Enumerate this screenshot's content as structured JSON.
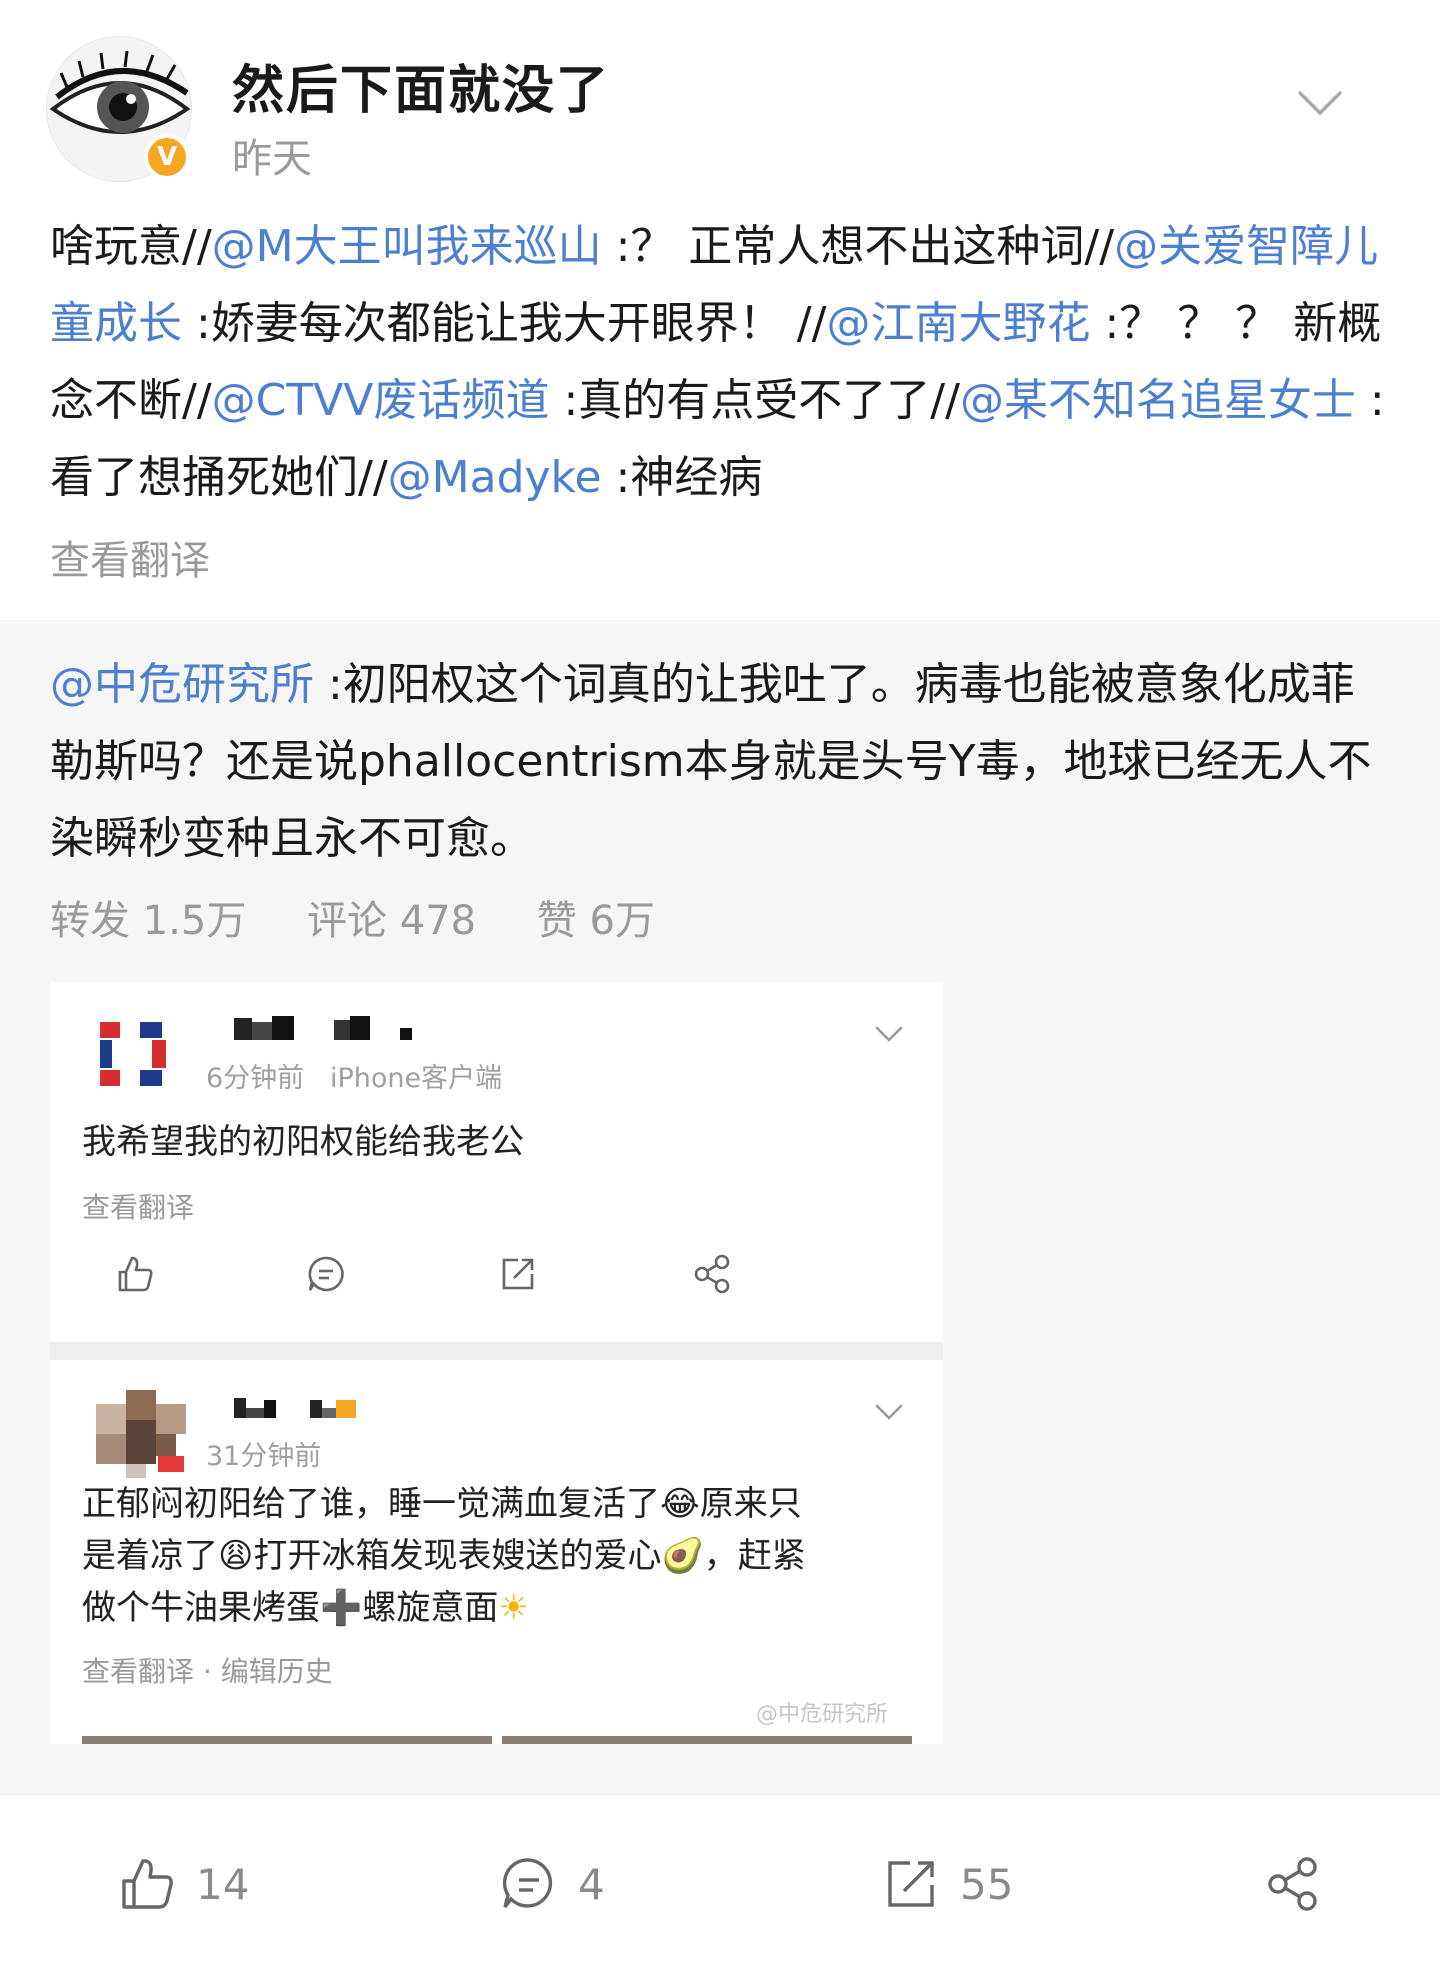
{
  "post": {
    "author": "然后下面就没了",
    "time": "昨天",
    "verified_badge": "V",
    "segments": [
      {
        "t": "啥玩意//",
        "m": false
      },
      {
        "t": "@M大王叫我来巡山",
        "m": true
      },
      {
        "t": " :？ 正常人想不出这种词//",
        "m": false
      },
      {
        "t": "@关爱智障儿童成长",
        "m": true
      },
      {
        "t": " :娇妻每次都能让我大开眼界！ //",
        "m": false
      },
      {
        "t": "@江南大野花",
        "m": true
      },
      {
        "t": " :？ ？ ？ 新概念不断//",
        "m": false
      },
      {
        "t": "@CTVV废话频道",
        "m": true
      },
      {
        "t": " :真的有点受不了了//",
        "m": false
      },
      {
        "t": "@某不知名追星女士",
        "m": true
      },
      {
        "t": " :看了想捅死她们//",
        "m": false
      },
      {
        "t": "@Madyke",
        "m": true
      },
      {
        "t": " :神经病",
        "m": false
      }
    ],
    "translate_label": "查看翻译"
  },
  "repost": {
    "mention": "@中危研究所",
    "text": " :初阳权这个词真的让我吐了。病毒也能被意象化成菲勒斯吗？还是说phallocentrism本身就是头号Y毒，地球已经无人不染瞬秒变种且永不可愈。",
    "stats": {
      "forward_label": "转发 1.5万",
      "comment_label": "评论 478",
      "like_label": "赞 6万"
    }
  },
  "card1": {
    "time": "6分钟前",
    "client": "iPhone客户端",
    "text": "我希望我的初阳权能给我老公",
    "translate_label": "查看翻译"
  },
  "card2": {
    "time": "31分钟前",
    "line1": "正郁闷初阳给了谁，睡一觉满血复活了",
    "emoji1": "😂",
    "line1b": "原来只",
    "line2a": "是着凉了",
    "emoji2": "😩",
    "line2b": "打开冰箱发现表嫂送的爱心",
    "emoji3": "🥑",
    "line2c": "，赶紧",
    "line3a": "做个牛油果烤蛋",
    "emoji4": "➕",
    "line3b": "螺旋意面",
    "emoji5": "☀",
    "footer": "查看翻译 · 编辑历史",
    "watermark": "@中危研究所"
  },
  "bottom_bar": {
    "likes": "14",
    "comments": "4",
    "reposts": "55"
  },
  "colors": {
    "mention": "#4c7fd0",
    "muted": "#9a9a9a",
    "badge": "#f5a623",
    "repost_bg": "#f6f6f6"
  }
}
